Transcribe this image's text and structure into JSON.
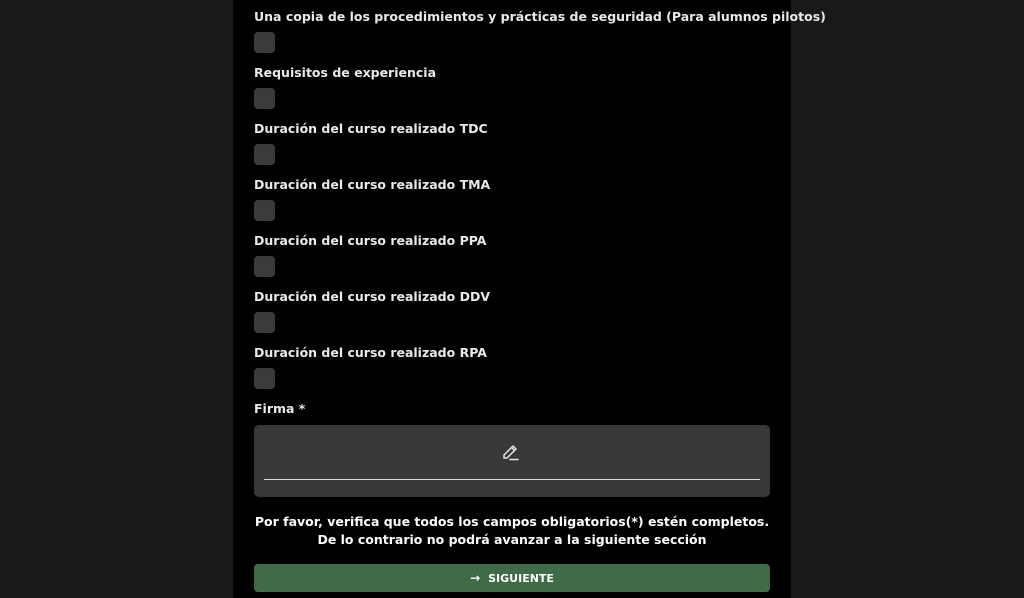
{
  "form": {
    "fields": [
      {
        "label": "Una copia de los procedimientos y prácticas de seguridad (Para alumnos pilotos)"
      },
      {
        "label": "Requisitos de experiencia"
      },
      {
        "label": "Duración del curso realizado TDC"
      },
      {
        "label": "Duración del curso realizado TMA"
      },
      {
        "label": "Duración del curso realizado PPA"
      },
      {
        "label": "Duración del curso realizado DDV"
      },
      {
        "label": "Duración del curso realizado RPA"
      }
    ],
    "signature": {
      "label": "Firma *",
      "icon": "pen-icon"
    },
    "notice": "Por favor, verifica que todos los campos obligatorios(*) estén completos. De lo contrario no podrá avanzar a la siguiente sección",
    "next_button": {
      "arrow": "→",
      "label": "SIGUIENTE"
    }
  },
  "colors": {
    "background": "#191919",
    "panel": "#000000",
    "checkbox": "#3b3b3b",
    "signature_pad": "#383838",
    "button": "#3f6b46"
  }
}
